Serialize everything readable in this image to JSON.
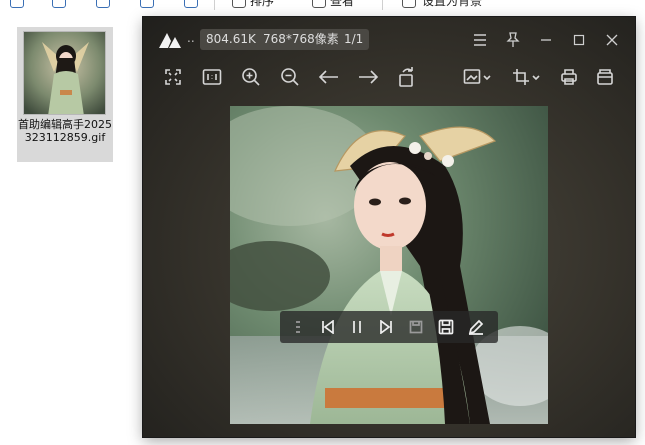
{
  "explorer": {
    "toolbar": {
      "sort_label": "排序",
      "view_label": "查看",
      "wallpaper_label": "设置为背景",
      "more_label": "···"
    },
    "file": {
      "name": "首助编辑高手2025323112859.gif"
    }
  },
  "viewer": {
    "title_ellipsis": "..",
    "file_size": "804.61K",
    "dimensions": "768*768像素",
    "page_counter": "1/1",
    "accent_color": "#2d2b27",
    "title_icons": [
      "menu-icon",
      "pin-icon",
      "minimize-icon",
      "maximize-icon",
      "close-icon"
    ],
    "toolbar_icons": [
      "fullscreen-icon",
      "actual-size-icon",
      "zoom-in-icon",
      "zoom-out-icon",
      "previous-arrow-icon",
      "next-arrow-icon",
      "rotate-icon",
      "image-adjust-icon",
      "crop-icon",
      "print-icon",
      "open-folder-icon"
    ],
    "playback_icons": [
      "frames-list-icon",
      "skip-back-icon",
      "pause-icon",
      "skip-forward-icon",
      "save-frame-icon",
      "save-icon",
      "edit-icon"
    ]
  }
}
